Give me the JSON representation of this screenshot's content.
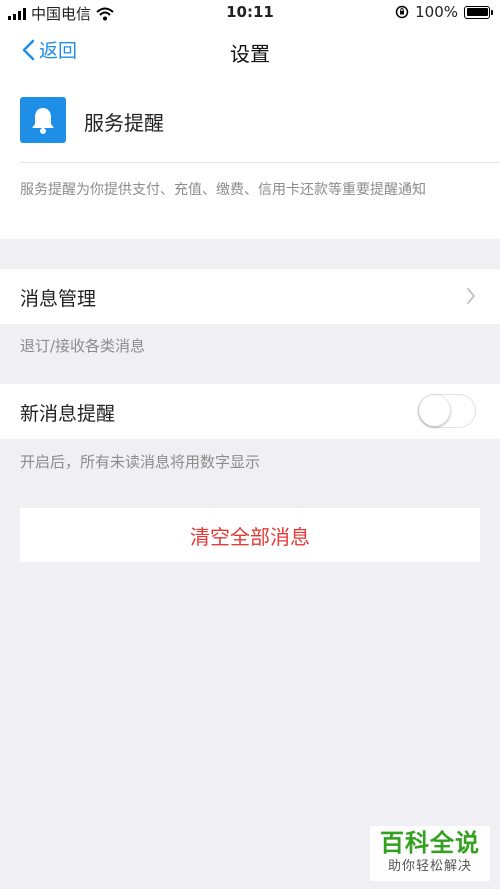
{
  "status_bar": {
    "carrier": "中国电信",
    "time": "10:11",
    "battery": "100%"
  },
  "nav": {
    "back_label": "返回",
    "title": "设置"
  },
  "service": {
    "name": "服务提醒",
    "description": "服务提醒为你提供支付、充值、缴费、信用卡还款等重要提醒通知"
  },
  "message_management": {
    "label": "消息管理",
    "hint": "退订/接收各类消息"
  },
  "new_message_alert": {
    "label": "新消息提醒",
    "enabled": false,
    "hint": "开启后，所有未读消息将用数字显示"
  },
  "clear_button": {
    "label": "清空全部消息",
    "color": "#e53935"
  },
  "watermark": {
    "title": "百科全说",
    "subtitle": "助你轻松解决"
  },
  "colors": {
    "accent": "#1f8ee6",
    "background": "#efeff4"
  }
}
